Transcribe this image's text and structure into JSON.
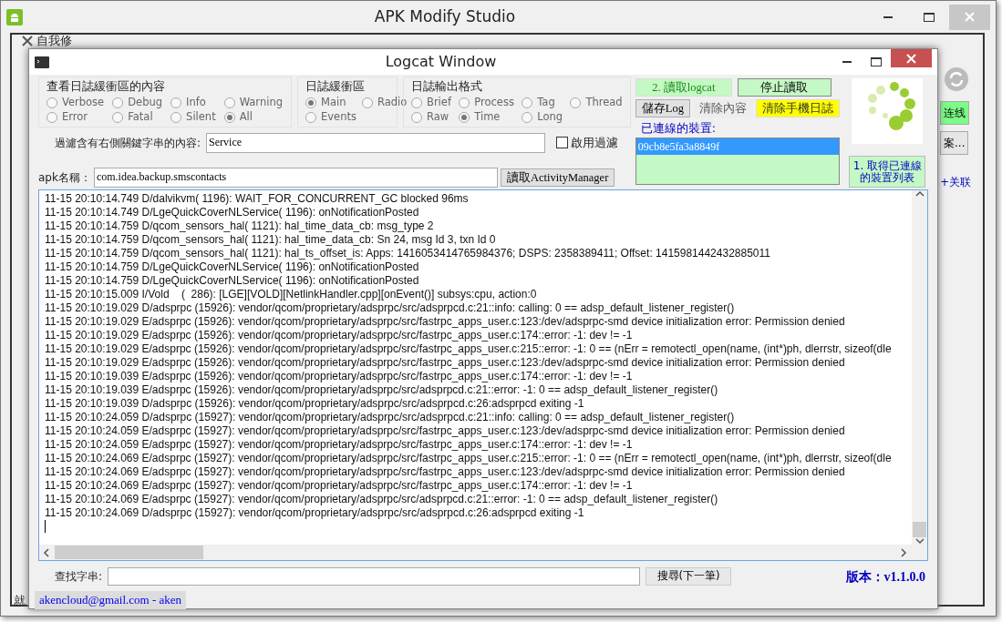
{
  "main_window": {
    "title": "APK Modify Studio",
    "toolbar_item": "自我修",
    "side_buttons": [
      {
        "label": "连线",
        "kind": "green"
      },
      {
        "label": "案...",
        "kind": "plain"
      }
    ],
    "side_link": "+关联",
    "status_text": "就"
  },
  "logcat_window": {
    "title": "Logcat Window",
    "level_group": {
      "title": "查看日誌緩衝區的內容",
      "options": [
        {
          "label": "Verbose",
          "selected": false
        },
        {
          "label": "Debug",
          "selected": false
        },
        {
          "label": "Info",
          "selected": false
        },
        {
          "label": "Warning",
          "selected": false
        },
        {
          "label": "Error",
          "selected": false
        },
        {
          "label": "Fatal",
          "selected": false
        },
        {
          "label": "Silent",
          "selected": false
        },
        {
          "label": "All",
          "selected": true
        }
      ]
    },
    "buffer_group": {
      "title": "日誌緩衝區",
      "options": [
        {
          "label": "Main",
          "selected": true
        },
        {
          "label": "Radio",
          "selected": false
        },
        {
          "label": "Events",
          "selected": false
        }
      ]
    },
    "format_group": {
      "title": "日誌輸出格式",
      "options": [
        {
          "label": "Brief",
          "selected": false
        },
        {
          "label": "Process",
          "selected": false
        },
        {
          "label": "Tag",
          "selected": false
        },
        {
          "label": "Thread",
          "selected": false
        },
        {
          "label": "Raw",
          "selected": false
        },
        {
          "label": "Time",
          "selected": true
        },
        {
          "label": "Long",
          "selected": false
        }
      ]
    },
    "filter": {
      "label": "過濾含有右側關鍵字串的內容:",
      "value": "Service",
      "enable_label": "啟用過濾",
      "enabled": false
    },
    "apk": {
      "label": "apk名稱：",
      "value": "com.idea.backup.smscontacts",
      "button": "讀取ActivityManager"
    },
    "buttons": [
      {
        "label": "2. 讀取logcat",
        "kind": "green"
      },
      {
        "label": "停止讀取",
        "kind": "green-dark"
      },
      {
        "label": "儲存Log",
        "kind": "plain"
      },
      {
        "label": "清除內容",
        "kind": "flat"
      },
      {
        "label": "清除手機日誌",
        "kind": "yellow"
      }
    ],
    "devices": {
      "label": "已連線的裝置:",
      "items": [
        {
          "name": "09cb8e5fa3a8849f",
          "selected": true
        }
      ]
    },
    "list_devices_button": "1. 取得已連線的裝置列表",
    "log_lines": [
      "11-15 20:10:14.749 D/dalvikvm( 1196): WAIT_FOR_CONCURRENT_GC blocked 96ms",
      "11-15 20:10:14.749 D/LgeQuickCoverNLService( 1196): onNotificationPosted",
      "11-15 20:10:14.759 D/qcom_sensors_hal( 1121): hal_time_data_cb: msg_type 2",
      "11-15 20:10:14.759 D/qcom_sensors_hal( 1121): hal_time_data_cb: Sn 24, msg Id 3, txn Id 0",
      "11-15 20:10:14.759 D/qcom_sensors_hal( 1121): hal_ts_offset_is: Apps: 1416053414765984376; DSPS: 2358389411; Offset: 1415981442432885011",
      "11-15 20:10:14.759 D/LgeQuickCoverNLService( 1196): onNotificationPosted",
      "11-15 20:10:14.759 D/LgeQuickCoverNLService( 1196): onNotificationPosted",
      "11-15 20:10:15.009 I/Vold    (  286): [LGE][VOLD][NetlinkHandler.cpp][onEvent()] subsys:cpu, action:0",
      "11-15 20:10:19.029 D/adsprpc (15926): vendor/qcom/proprietary/adsprpc/src/adsprpcd.c:21::info: calling: 0 == adsp_default_listener_register()",
      "11-15 20:10:19.029 E/adsprpc (15926): vendor/qcom/proprietary/adsprpc/src/fastrpc_apps_user.c:123:/dev/adsprpc-smd device initialization error: Permission denied",
      "11-15 20:10:19.029 E/adsprpc (15926): vendor/qcom/proprietary/adsprpc/src/fastrpc_apps_user.c:174::error: -1: dev != -1",
      "11-15 20:10:19.029 E/adsprpc (15926): vendor/qcom/proprietary/adsprpc/src/fastrpc_apps_user.c:215::error: -1: 0 == (nErr = remotectl_open(name, (int*)ph, dlerrstr, sizeof(dle",
      "11-15 20:10:19.029 E/adsprpc (15926): vendor/qcom/proprietary/adsprpc/src/fastrpc_apps_user.c:123:/dev/adsprpc-smd device initialization error: Permission denied",
      "11-15 20:10:19.039 E/adsprpc (15926): vendor/qcom/proprietary/adsprpc/src/fastrpc_apps_user.c:174::error: -1: dev != -1",
      "11-15 20:10:19.039 E/adsprpc (15926): vendor/qcom/proprietary/adsprpc/src/adsprpcd.c:21::error: -1: 0 == adsp_default_listener_register()",
      "11-15 20:10:19.039 D/adsprpc (15926): vendor/qcom/proprietary/adsprpc/src/adsprpcd.c:26:adsprpcd exiting -1",
      "11-15 20:10:24.059 D/adsprpc (15927): vendor/qcom/proprietary/adsprpc/src/adsprpcd.c:21::info: calling: 0 == adsp_default_listener_register()",
      "11-15 20:10:24.059 E/adsprpc (15927): vendor/qcom/proprietary/adsprpc/src/fastrpc_apps_user.c:123:/dev/adsprpc-smd device initialization error: Permission denied",
      "11-15 20:10:24.059 E/adsprpc (15927): vendor/qcom/proprietary/adsprpc/src/fastrpc_apps_user.c:174::error: -1: dev != -1",
      "11-15 20:10:24.069 E/adsprpc (15927): vendor/qcom/proprietary/adsprpc/src/fastrpc_apps_user.c:215::error: -1: 0 == (nErr = remotectl_open(name, (int*)ph, dlerrstr, sizeof(dle",
      "11-15 20:10:24.069 E/adsprpc (15927): vendor/qcom/proprietary/adsprpc/src/fastrpc_apps_user.c:123:/dev/adsprpc-smd device initialization error: Permission denied",
      "11-15 20:10:24.069 E/adsprpc (15927): vendor/qcom/proprietary/adsprpc/src/fastrpc_apps_user.c:174::error: -1: dev != -1",
      "11-15 20:10:24.069 E/adsprpc (15927): vendor/qcom/proprietary/adsprpc/src/adsprpcd.c:21::error: -1: 0 == adsp_default_listener_register()",
      "11-15 20:10:24.069 D/adsprpc (15927): vendor/qcom/proprietary/adsprpc/src/adsprpcd.c:26:adsprpcd exiting -1"
    ],
    "search": {
      "label": "查找字串:",
      "button": "搜尋(下一筆)"
    },
    "version": "版本：v1.1.0.0",
    "status": "akencloud@gmail.com - aken"
  }
}
